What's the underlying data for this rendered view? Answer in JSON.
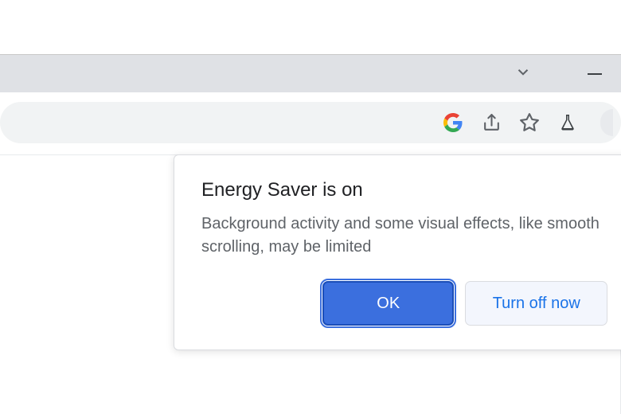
{
  "popover": {
    "title": "Energy Saver is on",
    "body": "Background activity and some visual effects, like smooth scrolling, may be limited",
    "ok_label": "OK",
    "turn_off_label": "Turn off now"
  }
}
